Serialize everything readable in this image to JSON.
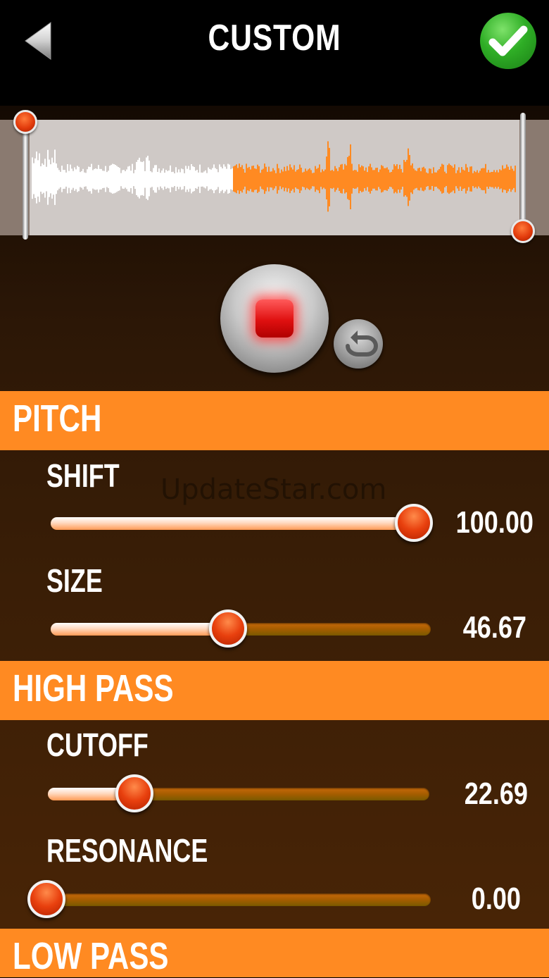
{
  "header": {
    "title": "CUSTOM",
    "back_icon": "triangle-left-icon",
    "confirm_icon": "checkmark-icon"
  },
  "waveform": {
    "played_color": "#ffffff",
    "remaining_color": "#ff8a22",
    "start_handle": 0.0,
    "end_handle": 1.0
  },
  "controls": {
    "record_icon": "stop-square-icon",
    "loop_icon": "loop-arrow-icon"
  },
  "watermark": "UpdateStar.com",
  "sections": [
    {
      "title": "PITCH",
      "params": [
        {
          "label": "SHIFT",
          "value": "100.00",
          "fraction": 1.0
        },
        {
          "label": "SIZE",
          "value": "46.67",
          "fraction": 0.4667
        }
      ]
    },
    {
      "title": "HIGH PASS",
      "params": [
        {
          "label": "CUTOFF",
          "value": "22.69",
          "fraction": 0.2269
        },
        {
          "label": "RESONANCE",
          "value": "0.00",
          "fraction": 0.0
        }
      ]
    },
    {
      "title": "LOW PASS",
      "params": []
    }
  ],
  "colors": {
    "accent": "#ff8a22",
    "slider_thumb": "#e8400e",
    "confirm": "#2fae26"
  }
}
